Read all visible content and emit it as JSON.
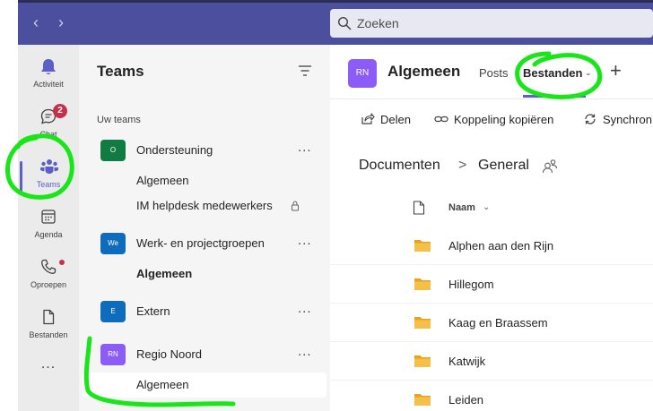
{
  "search": {
    "placeholder": "Zoeken"
  },
  "rail": {
    "items": [
      {
        "label": "Activiteit"
      },
      {
        "label": "Chat",
        "badge": "2"
      },
      {
        "label": "Teams"
      },
      {
        "label": "Agenda"
      },
      {
        "label": "Oproepen"
      },
      {
        "label": "Bestanden"
      }
    ],
    "more": "..."
  },
  "teams_panel": {
    "title": "Teams",
    "section_label": "Uw teams",
    "teams": [
      {
        "avatar": "O",
        "avatar_color": "#107c41",
        "name": "Ondersteuning",
        "more": "...",
        "channels": [
          "Algemeen",
          "IM helpdesk medewerkers"
        ]
      },
      {
        "avatar": "We",
        "avatar_color": "#0f6cbd",
        "name": "Werk- en projectgroepen",
        "more": "...",
        "channels": [
          "Algemeen"
        ]
      },
      {
        "avatar": "E",
        "avatar_color": "#0f6cbd",
        "name": "Extern",
        "more": "...",
        "channels": []
      },
      {
        "avatar": "RN",
        "avatar_color": "#8b5cf6",
        "name": "Regio Noord",
        "more": "...",
        "channels": [
          "Algemeen"
        ]
      }
    ]
  },
  "main": {
    "avatar": "RN",
    "title": "Algemeen",
    "tabs": {
      "posts": "Posts",
      "files": "Bestanden"
    },
    "add": "+",
    "toolbar": {
      "share": "Delen",
      "copy_link": "Koppeling kopiëren",
      "sync": "Synchron"
    },
    "breadcrumb": {
      "documents": "Documenten",
      "separator": ">",
      "current": "General"
    },
    "list_header": {
      "name": "Naam"
    },
    "files": [
      {
        "name": "Alphen aan den Rijn"
      },
      {
        "name": "Hillegom"
      },
      {
        "name": "Kaag en Braassem"
      },
      {
        "name": "Katwijk"
      },
      {
        "name": "Leiden"
      }
    ]
  },
  "colors": {
    "topbar": "#4b4f9e",
    "accent": "#5b5fc7",
    "highlight": "#19e619",
    "folder": "#f5b82e"
  }
}
